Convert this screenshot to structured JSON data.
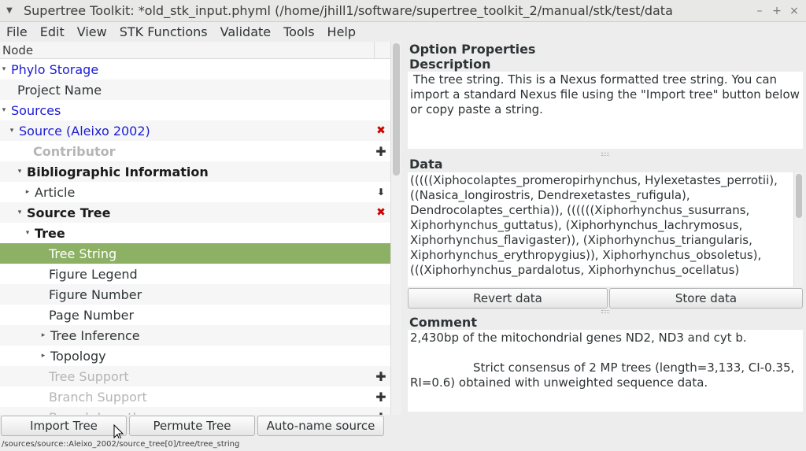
{
  "window": {
    "title": "Supertree Toolkit: *old_stk_input.phyml (/home/jhill1/software/supertree_toolkit_2/manual/stk/test/data",
    "buttons": [
      "–",
      "+",
      "×"
    ]
  },
  "menubar": [
    "File",
    "Edit",
    "View",
    "STK Functions",
    "Validate",
    "Tools",
    "Help"
  ],
  "tree": {
    "header": "Node",
    "rows": [
      {
        "label": "Phylo Storage",
        "indent": 0,
        "expander": "▾",
        "style": "blue",
        "action": ""
      },
      {
        "label": "Project Name",
        "indent": 1,
        "expander": "",
        "style": "normal",
        "action": ""
      },
      {
        "label": "Sources",
        "indent": 1,
        "expander": "▾",
        "style": "blue",
        "action": ""
      },
      {
        "label": "Source (Aleixo 2002)",
        "indent": 2,
        "expander": "▾",
        "style": "blue",
        "action": "delete"
      },
      {
        "label": "Contributor",
        "indent": 3,
        "expander": "",
        "style": "greybold",
        "action": "add"
      },
      {
        "label": "Bibliographic Information",
        "indent": 3,
        "expander": "▾",
        "style": "bold",
        "action": ""
      },
      {
        "label": "Article",
        "indent": 4,
        "expander": "▸",
        "style": "normal",
        "action": "down"
      },
      {
        "label": "Source Tree",
        "indent": 3,
        "expander": "▾",
        "style": "bold",
        "action": "delete"
      },
      {
        "label": "Tree",
        "indent": 4,
        "expander": "▾",
        "style": "bold",
        "action": ""
      },
      {
        "label": "Tree String",
        "indent": 5,
        "expander": "",
        "style": "selected",
        "action": ""
      },
      {
        "label": "Figure Legend",
        "indent": 5,
        "expander": "",
        "style": "normal",
        "action": ""
      },
      {
        "label": "Figure Number",
        "indent": 5,
        "expander": "",
        "style": "normal",
        "action": ""
      },
      {
        "label": "Page Number",
        "indent": 5,
        "expander": "",
        "style": "normal",
        "action": ""
      },
      {
        "label": "Tree Inference",
        "indent": 5,
        "expander": "▸",
        "style": "normal",
        "action": ""
      },
      {
        "label": "Topology",
        "indent": 5,
        "expander": "▸",
        "style": "normal",
        "action": ""
      },
      {
        "label": "Tree Support",
        "indent": 5,
        "expander": "",
        "style": "grey",
        "action": "add"
      },
      {
        "label": "Branch Support",
        "indent": 5,
        "expander": "",
        "style": "grey",
        "action": "add"
      },
      {
        "label": "Branch Lengths",
        "indent": 5,
        "expander": "",
        "style": "grey",
        "action": "add"
      }
    ]
  },
  "options": {
    "heading": "Option Properties",
    "description_title": "Description",
    "description": "The tree string. This is a Nexus formatted tree string. You can import a standard Nexus file using the \"Import tree\" button below or copy  paste a string.",
    "data_title": "Data",
    "data": "(((((Xiphocolaptes_promeropirhynchus, Hylexetastes_perrotii), ((Nasica_longirostris, Dendrexetastes_rufigula), Dendrocolaptes_certhia)), ((((((Xiphorhynchus_susurrans, Xiphorhynchus_guttatus), (Xiphorhynchus_lachrymosus, Xiphorhynchus_flavigaster)), (Xiphorhynchus_triangularis, Xiphorhynchus_erythropygius)), Xiphorhynchus_obsoletus), (((Xiphorhynchus_pardalotus, Xiphorhynchus_ocellatus)",
    "revert_label": "Revert data",
    "store_label": "Store data",
    "comment_title": "Comment",
    "comment_line1": "2,430bp of the mitochondrial genes ND2, ND3 and cyt b.",
    "comment_line2": "Strict consensus of 2 MP trees (length=3,133, CI-0.35, RI=0.6) obtained with unweighted sequence data."
  },
  "bottom_buttons": {
    "import": "Import Tree",
    "permute": "Permute Tree",
    "autoname": "Auto-name source"
  },
  "status_path": "/sources/source::Aleixo_2002/source_tree[0]/tree/tree_string"
}
